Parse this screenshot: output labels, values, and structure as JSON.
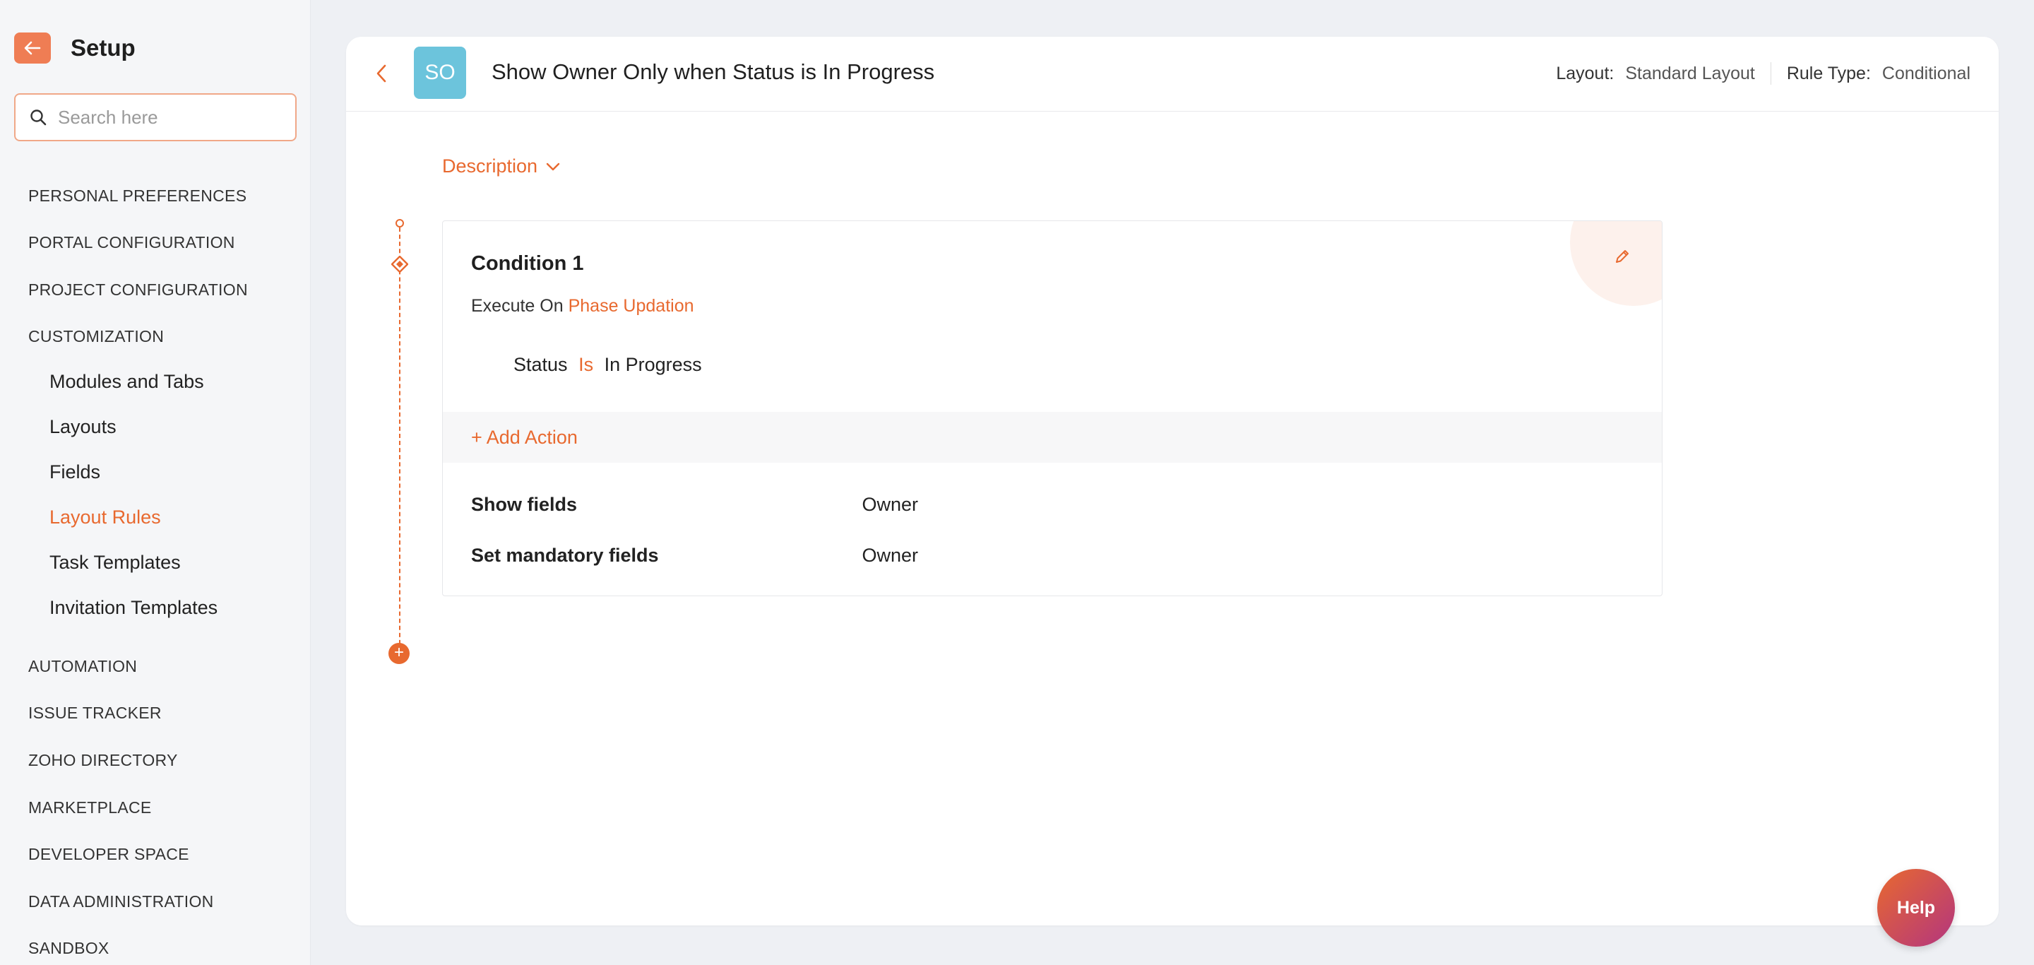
{
  "sidebar": {
    "title": "Setup",
    "search_placeholder": "Search here",
    "sections": [
      "PERSONAL PREFERENCES",
      "PORTAL CONFIGURATION",
      "PROJECT CONFIGURATION",
      "CUSTOMIZATION"
    ],
    "customization_items": [
      "Modules and Tabs",
      "Layouts",
      "Fields",
      "Layout Rules",
      "Task Templates",
      "Invitation Templates"
    ],
    "active_item": "Layout Rules",
    "sections_after": [
      "AUTOMATION",
      "ISSUE TRACKER",
      "ZOHO DIRECTORY",
      "MARKETPLACE",
      "DEVELOPER SPACE",
      "DATA ADMINISTRATION",
      "SANDBOX"
    ]
  },
  "header": {
    "avatar_initials": "SO",
    "rule_title": "Show Owner Only when Status is In Progress",
    "layout_label": "Layout:",
    "layout_value": "Standard Layout",
    "rule_type_label": "Rule Type:",
    "rule_type_value": "Conditional"
  },
  "description_label": "Description",
  "condition": {
    "title": "Condition 1",
    "execute_on_label": "Execute On",
    "execute_on_value": "Phase Updation",
    "criteria": {
      "field": "Status",
      "operator": "Is",
      "value": "In Progress"
    },
    "add_action_label": "+ Add Action",
    "actions": [
      {
        "label": "Show fields",
        "value": "Owner"
      },
      {
        "label": "Set mandatory fields",
        "value": "Owner"
      }
    ]
  },
  "help_label": "Help",
  "colors": {
    "accent": "#e8692f",
    "avatar": "#6cc4dc",
    "back_button": "#ef7d54"
  }
}
